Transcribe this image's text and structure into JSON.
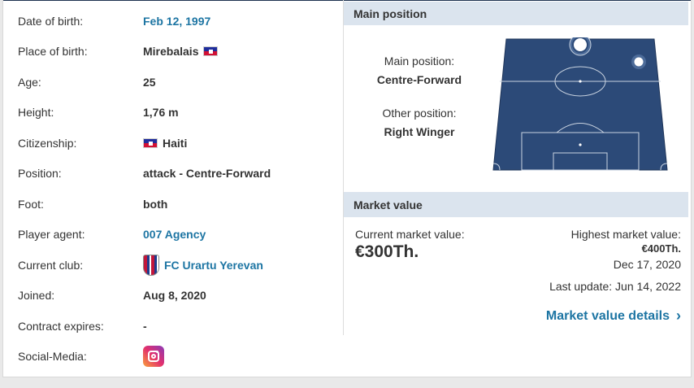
{
  "profile": {
    "rows": [
      {
        "label": "Date of birth:",
        "value": "Feb 12, 1997"
      },
      {
        "label": "Place of birth:",
        "value": "Mirebalais"
      },
      {
        "label": "Age:",
        "value": "25"
      },
      {
        "label": "Height:",
        "value": "1,76 m"
      },
      {
        "label": "Citizenship:",
        "value": "Haiti"
      },
      {
        "label": "Position:",
        "value": "attack - Centre-Forward"
      },
      {
        "label": "Foot:",
        "value": "both"
      },
      {
        "label": "Player agent:",
        "value": "007 Agency"
      },
      {
        "label": "Current club:",
        "value": "FC Urartu Yerevan"
      },
      {
        "label": "Joined:",
        "value": "Aug 8, 2020"
      },
      {
        "label": "Contract expires:",
        "value": "-"
      },
      {
        "label": "Social-Media:",
        "value": ""
      }
    ]
  },
  "position": {
    "header": "Main position",
    "main_label": "Main position:",
    "main_value": "Centre-Forward",
    "other_label": "Other position:",
    "other_value": "Right Winger"
  },
  "market": {
    "header": "Market value",
    "current_label": "Current market value:",
    "current_value": "€300Th.",
    "highest_label": "Highest market value:",
    "highest_value": "€400Th.",
    "highest_date": "Dec 17, 2020",
    "last_update": "Last update: Jun 14, 2022",
    "details_link": "Market value details"
  },
  "icons": {
    "flag": "haiti-flag-icon",
    "club": "club-crest-icon",
    "social": "instagram-icon",
    "chevron": "chevron-right-icon"
  },
  "colors": {
    "link": "#1d75a3",
    "header_bg": "#dbe4ee",
    "pitch": "#2c4a78"
  }
}
